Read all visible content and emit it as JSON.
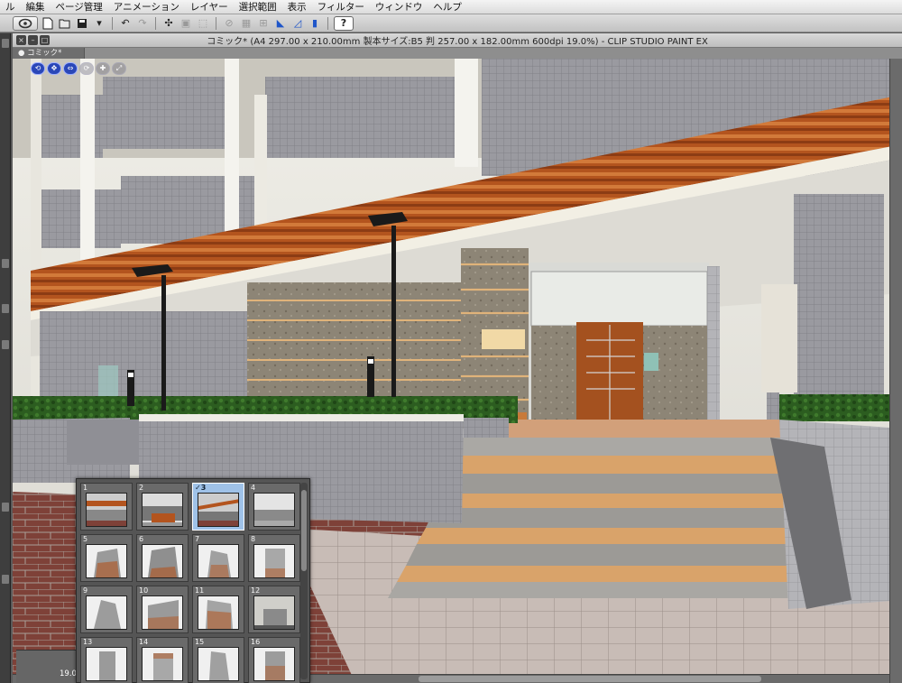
{
  "menubar": {
    "items": [
      "ル",
      "編集",
      "ページ管理",
      "アニメーション",
      "レイヤー",
      "選択範囲",
      "表示",
      "フィルター",
      "ウィンドウ",
      "ヘルプ"
    ]
  },
  "toolbar": {
    "icons": [
      "clip-studio-logo-icon",
      "new-file-icon",
      "open-file-icon",
      "save-icon",
      "save-dropdown-icon",
      "undo-icon",
      "redo-icon",
      "transform-icon",
      "snap-icon",
      "selection-icon",
      "ruler-snap-icon",
      "special-ruler-icon",
      "grid-icon",
      "perspective-snap-icon",
      "ruler-icon",
      "pen-pressure-icon",
      "help-icon"
    ],
    "help_label": "?"
  },
  "window": {
    "title": "コミック* (A4 297.00 x 210.00mm 製本サイズ:B5 判 257.00 x 182.00mm 600dpi 19.0%)  - CLIP STUDIO PAINT EX",
    "tab_label": "● コミック*",
    "zoom_label": "19.0"
  },
  "pages": {
    "items": [
      {
        "num": "1",
        "selected": false
      },
      {
        "num": "2",
        "selected": false
      },
      {
        "num": "✓3",
        "selected": true
      },
      {
        "num": "4",
        "selected": false
      },
      {
        "num": "5",
        "selected": false
      },
      {
        "num": "6",
        "selected": false
      },
      {
        "num": "7",
        "selected": false
      },
      {
        "num": "8",
        "selected": false
      },
      {
        "num": "9",
        "selected": false
      },
      {
        "num": "10",
        "selected": false
      },
      {
        "num": "11",
        "selected": false
      },
      {
        "num": "12",
        "selected": false
      },
      {
        "num": "13",
        "selected": false
      },
      {
        "num": "14",
        "selected": false
      },
      {
        "num": "15",
        "selected": false
      },
      {
        "num": "16",
        "selected": false
      }
    ]
  },
  "colors": {
    "wood": "#b0521f",
    "tile": "#8e8e93",
    "brick": "#7a4038",
    "hedge": "#2a5a1e",
    "selection": "#9fc2e8"
  }
}
